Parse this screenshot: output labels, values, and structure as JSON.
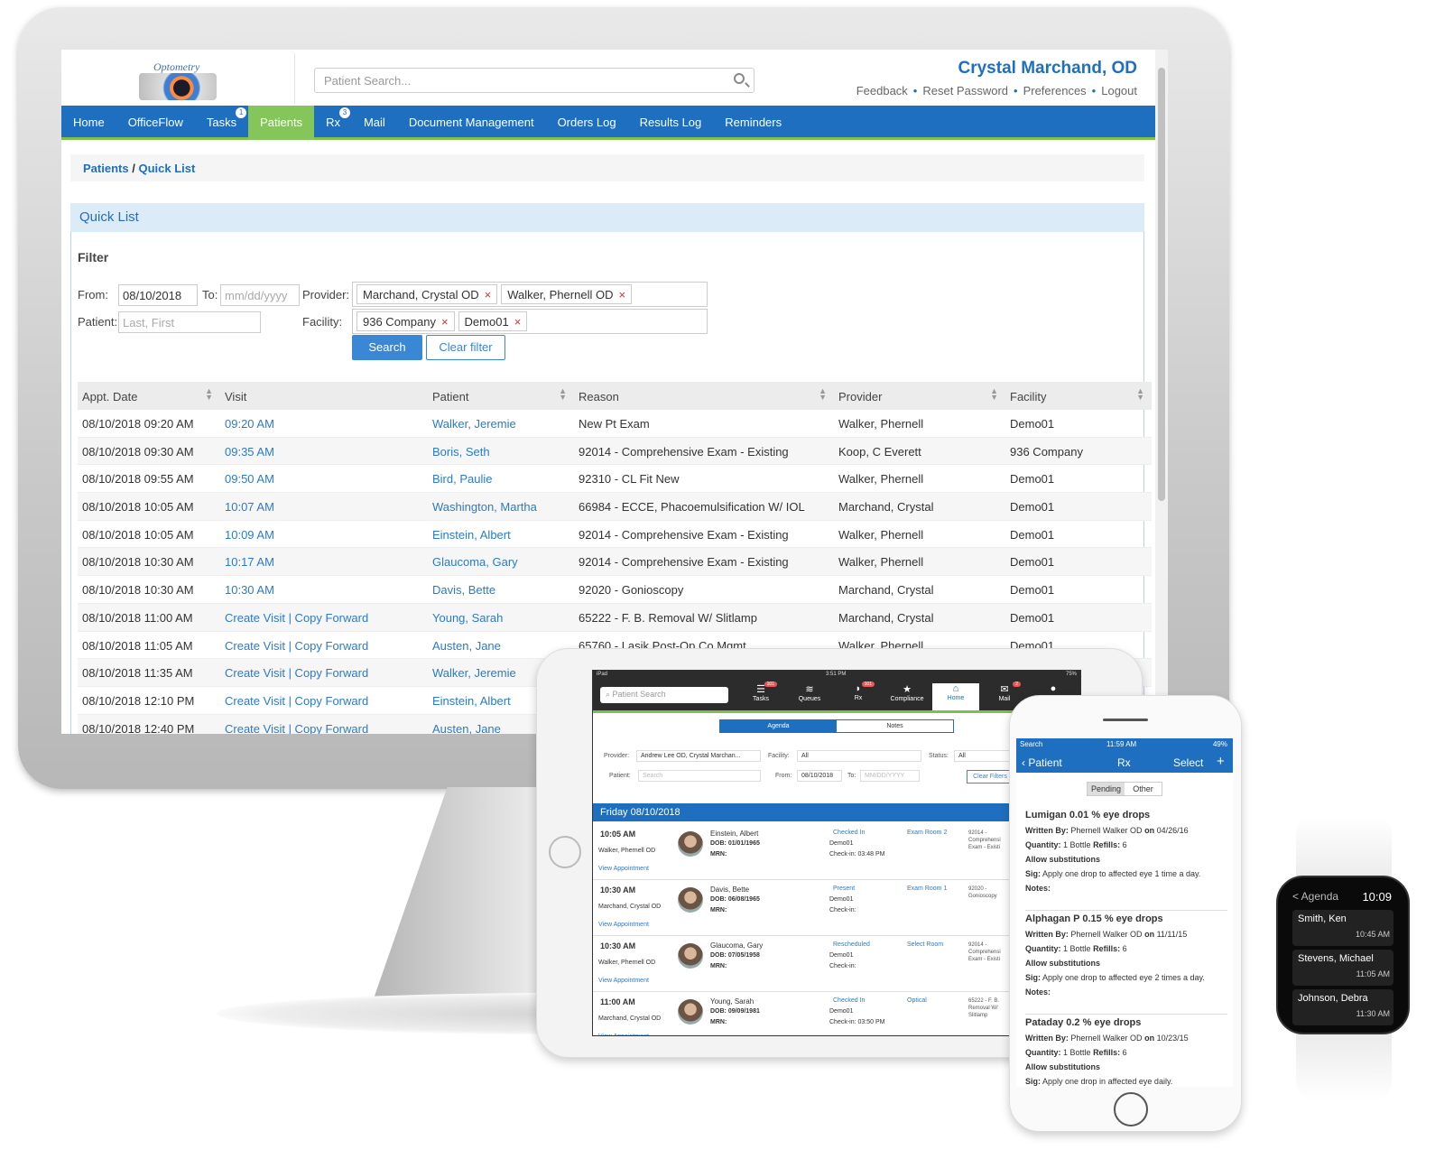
{
  "desktop": {
    "logo_text": "Optometry",
    "search_placeholder": "Patient Search...",
    "user_name": "Crystal Marchand, OD",
    "user_links": [
      "Feedback",
      "Reset Password",
      "Preferences",
      "Logout"
    ],
    "nav": [
      {
        "label": "Home"
      },
      {
        "label": "OfficeFlow"
      },
      {
        "label": "Tasks",
        "badge": "1"
      },
      {
        "label": "Patients",
        "active": true
      },
      {
        "label": "Rx",
        "badge": "3"
      },
      {
        "label": "Mail"
      },
      {
        "label": "Document Management"
      },
      {
        "label": "Orders Log"
      },
      {
        "label": "Results Log"
      },
      {
        "label": "Reminders"
      }
    ],
    "breadcrumb": {
      "parent": "Patients",
      "sep": "/",
      "current": "Quick List"
    },
    "panel_title": "Quick List",
    "filter": {
      "heading": "Filter",
      "from_label": "From:",
      "from_value": "08/10/2018",
      "to_label": "To:",
      "to_placeholder": "mm/dd/yyyy",
      "provider_label": "Provider:",
      "providers": [
        "Marchand, Crystal OD",
        "Walker, Phernell OD"
      ],
      "patient_label": "Patient:",
      "patient_placeholder": "Last, First",
      "facility_label": "Facility:",
      "facilities": [
        "936 Company",
        "Demo01"
      ],
      "search_btn": "Search",
      "clear_btn": "Clear filter"
    },
    "columns": [
      "Appt. Date",
      "Visit",
      "Patient",
      "Reason",
      "Provider",
      "Facility"
    ],
    "rows": [
      {
        "date": "08/10/2018 09:20 AM",
        "visit": "09:20 AM",
        "patient": "Walker, Jeremie",
        "reason": "New Pt Exam",
        "provider": "Walker, Phernell",
        "facility": "Demo01"
      },
      {
        "date": "08/10/2018 09:30 AM",
        "visit": "09:35 AM",
        "patient": "Boris, Seth",
        "reason": "92014 - Comprehensive Exam - Existing",
        "provider": "Koop, C Everett",
        "facility": "936 Company"
      },
      {
        "date": "08/10/2018 09:55 AM",
        "visit": "09:50 AM",
        "patient": "Bird, Paulie",
        "reason": "92310 - CL Fit New",
        "provider": "Walker, Phernell",
        "facility": "Demo01"
      },
      {
        "date": "08/10/2018 10:05 AM",
        "visit": "10:07 AM",
        "patient": "Washington, Martha",
        "reason": "66984 - ECCE, Phacoemulsification W/ IOL",
        "provider": "Marchand, Crystal",
        "facility": "Demo01"
      },
      {
        "date": "08/10/2018 10:05 AM",
        "visit": "10:09 AM",
        "patient": "Einstein, Albert",
        "reason": "92014 - Comprehensive Exam - Existing",
        "provider": "Walker, Phernell",
        "facility": "Demo01"
      },
      {
        "date": "08/10/2018 10:30 AM",
        "visit": "10:17 AM",
        "patient": "Glaucoma, Gary",
        "reason": "92014 - Comprehensive Exam - Existing",
        "provider": "Walker, Phernell",
        "facility": "Demo01"
      },
      {
        "date": "08/10/2018 10:30 AM",
        "visit": "10:30 AM",
        "patient": "Davis, Bette",
        "reason": "92020 - Gonioscopy",
        "provider": "Marchand, Crystal",
        "facility": "Demo01"
      },
      {
        "date": "08/10/2018 11:00 AM",
        "visit": "Create Visit | Copy Forward",
        "patient": "Young, Sarah",
        "reason": "65222 - F. B. Removal W/ Slitlamp",
        "provider": "Marchand, Crystal",
        "facility": "Demo01"
      },
      {
        "date": "08/10/2018 11:05 AM",
        "visit": "Create Visit | Copy Forward",
        "patient": "Austen, Jane",
        "reason": "65760 - Lasik Post-Op Co Mgmt",
        "provider": "Walker, Phernell",
        "facility": "Demo01"
      },
      {
        "date": "08/10/2018 11:35 AM",
        "visit": "Create Visit | Copy Forward",
        "patient": "Walker, Jeremie",
        "reason": "",
        "provider": "",
        "facility": ""
      },
      {
        "date": "08/10/2018 12:10 PM",
        "visit": "Create Visit | Copy Forward",
        "patient": "Einstein, Albert",
        "reason": "",
        "provider": "",
        "facility": ""
      },
      {
        "date": "08/10/2018 12:40 PM",
        "visit": "Create Visit | Copy Forward",
        "patient": "Austen, Jane",
        "reason": "",
        "provider": "",
        "facility": ""
      }
    ]
  },
  "tablet": {
    "status_left": "iPad",
    "status_time": "3:51 PM",
    "status_right": "75%",
    "search_placeholder": "Patient Search",
    "tabs": [
      {
        "label": "Tasks",
        "icon": "list-icon",
        "badge": "101"
      },
      {
        "label": "Queues",
        "icon": "stack-icon"
      },
      {
        "label": "Rx",
        "icon": "pill-icon",
        "badge": "101"
      },
      {
        "label": "Compliance",
        "icon": "star-icon"
      },
      {
        "label": "Home",
        "icon": "home-icon",
        "active": true
      },
      {
        "label": "Mail",
        "icon": "mail-icon",
        "badge": "2"
      },
      {
        "label": "",
        "icon": "user-icon"
      }
    ],
    "segments": [
      "Agenda",
      "Notes"
    ],
    "provider_label": "Provider:",
    "provider_value": "Andrew Lee OD, Crystal Marchan...",
    "facility_label": "Facility:",
    "facility_value": "All",
    "status_label": "Status:",
    "status_value": "All",
    "patient_label": "Patient:",
    "patient_placeholder": "Search",
    "from_label": "From:",
    "from_value": "08/10/2018",
    "to_label": "To:",
    "to_placeholder": "MM/DD/YYYY",
    "clear_btn": "Clear Filters",
    "day": "Friday 08/10/2018",
    "appointments": [
      {
        "time": "10:05 AM",
        "provider": "Walker, Phernell OD",
        "view": "View Appointment",
        "name": "Einstein, Albert",
        "dob": "DOB: 01/01/1965",
        "mrn": "MRN:",
        "status": "Checked In",
        "facility": "Demo01",
        "checkin": "Check-in: 03:48 PM",
        "room": "Exam Room 2",
        "reason": "92014 - Comprehensi Exam - Existi"
      },
      {
        "time": "10:30 AM",
        "provider": "Marchand, Crystal OD",
        "view": "View Appointment",
        "name": "Davis, Bette",
        "dob": "DOB: 06/08/1965",
        "mrn": "MRN:",
        "status": "Present",
        "facility": "Demo01",
        "checkin": "Check-in:",
        "room": "Exam Room 1",
        "reason": "92020 - Gonioscopy"
      },
      {
        "time": "10:30 AM",
        "provider": "Walker, Phernell OD",
        "view": "View Appointment",
        "name": "Glaucoma, Gary",
        "dob": "DOB: 07/05/1958",
        "mrn": "MRN:",
        "status": "Rescheduled",
        "facility": "Demo01",
        "checkin": "Check-in:",
        "room": "Select Room",
        "reason": "92014 - Comprehensi Exam - Existi"
      },
      {
        "time": "11:00 AM",
        "provider": "Marchand, Crystal OD",
        "view": "View Appointment",
        "name": "Young, Sarah",
        "dob": "DOB: 09/09/1981",
        "mrn": "MRN:",
        "status": "Checked In",
        "facility": "Demo01",
        "checkin": "Check-in: 03:50 PM",
        "room": "Optical",
        "reason": "65222 - F. B. Removal W/ Slitlamp"
      }
    ]
  },
  "phone": {
    "status_left": "Search",
    "status_time": "11:59 AM",
    "status_right": "49%",
    "back": "Patient",
    "title": "Rx",
    "select": "Select",
    "segments": [
      "Pending",
      "Other"
    ],
    "items": [
      {
        "name": "Lumigan 0.01 % eye drops",
        "written_by": "Phernell Walker OD",
        "on": "04/26/16",
        "quantity": "1 Bottle",
        "refills": "6",
        "subs": "Allow substitutions",
        "sig": "Apply one drop to affected eye 1 time a day.",
        "notes": "Notes:"
      },
      {
        "name": "Alphagan P 0.15 % eye drops",
        "written_by": "Phernell Walker OD",
        "on": "11/11/15",
        "quantity": "1 Bottle",
        "refills": "6",
        "subs": "Allow substitutions",
        "sig": "Apply one drop to affected eye 2 times a day.",
        "notes": "Notes:"
      },
      {
        "name": "Pataday 0.2 % eye drops",
        "written_by": "Phernell Walker OD",
        "on": "10/23/15",
        "quantity": "1 Bottle",
        "refills": "6",
        "subs": "Allow substitutions",
        "sig": "Apply one drop in affected eye daily.",
        "notes": ""
      }
    ],
    "labels": {
      "written_by": "Written By:",
      "on": "on",
      "quantity": "Quantity:",
      "refills": "Refills:",
      "sig": "Sig:"
    }
  },
  "watch": {
    "back": "< Agenda",
    "time": "10:09",
    "items": [
      {
        "name": "Smith, Ken",
        "time": "10:45 AM"
      },
      {
        "name": "Stevens, Michael",
        "time": "11:05 AM"
      },
      {
        "name": "Johnson, Debra",
        "time": "11:30 AM"
      }
    ]
  }
}
